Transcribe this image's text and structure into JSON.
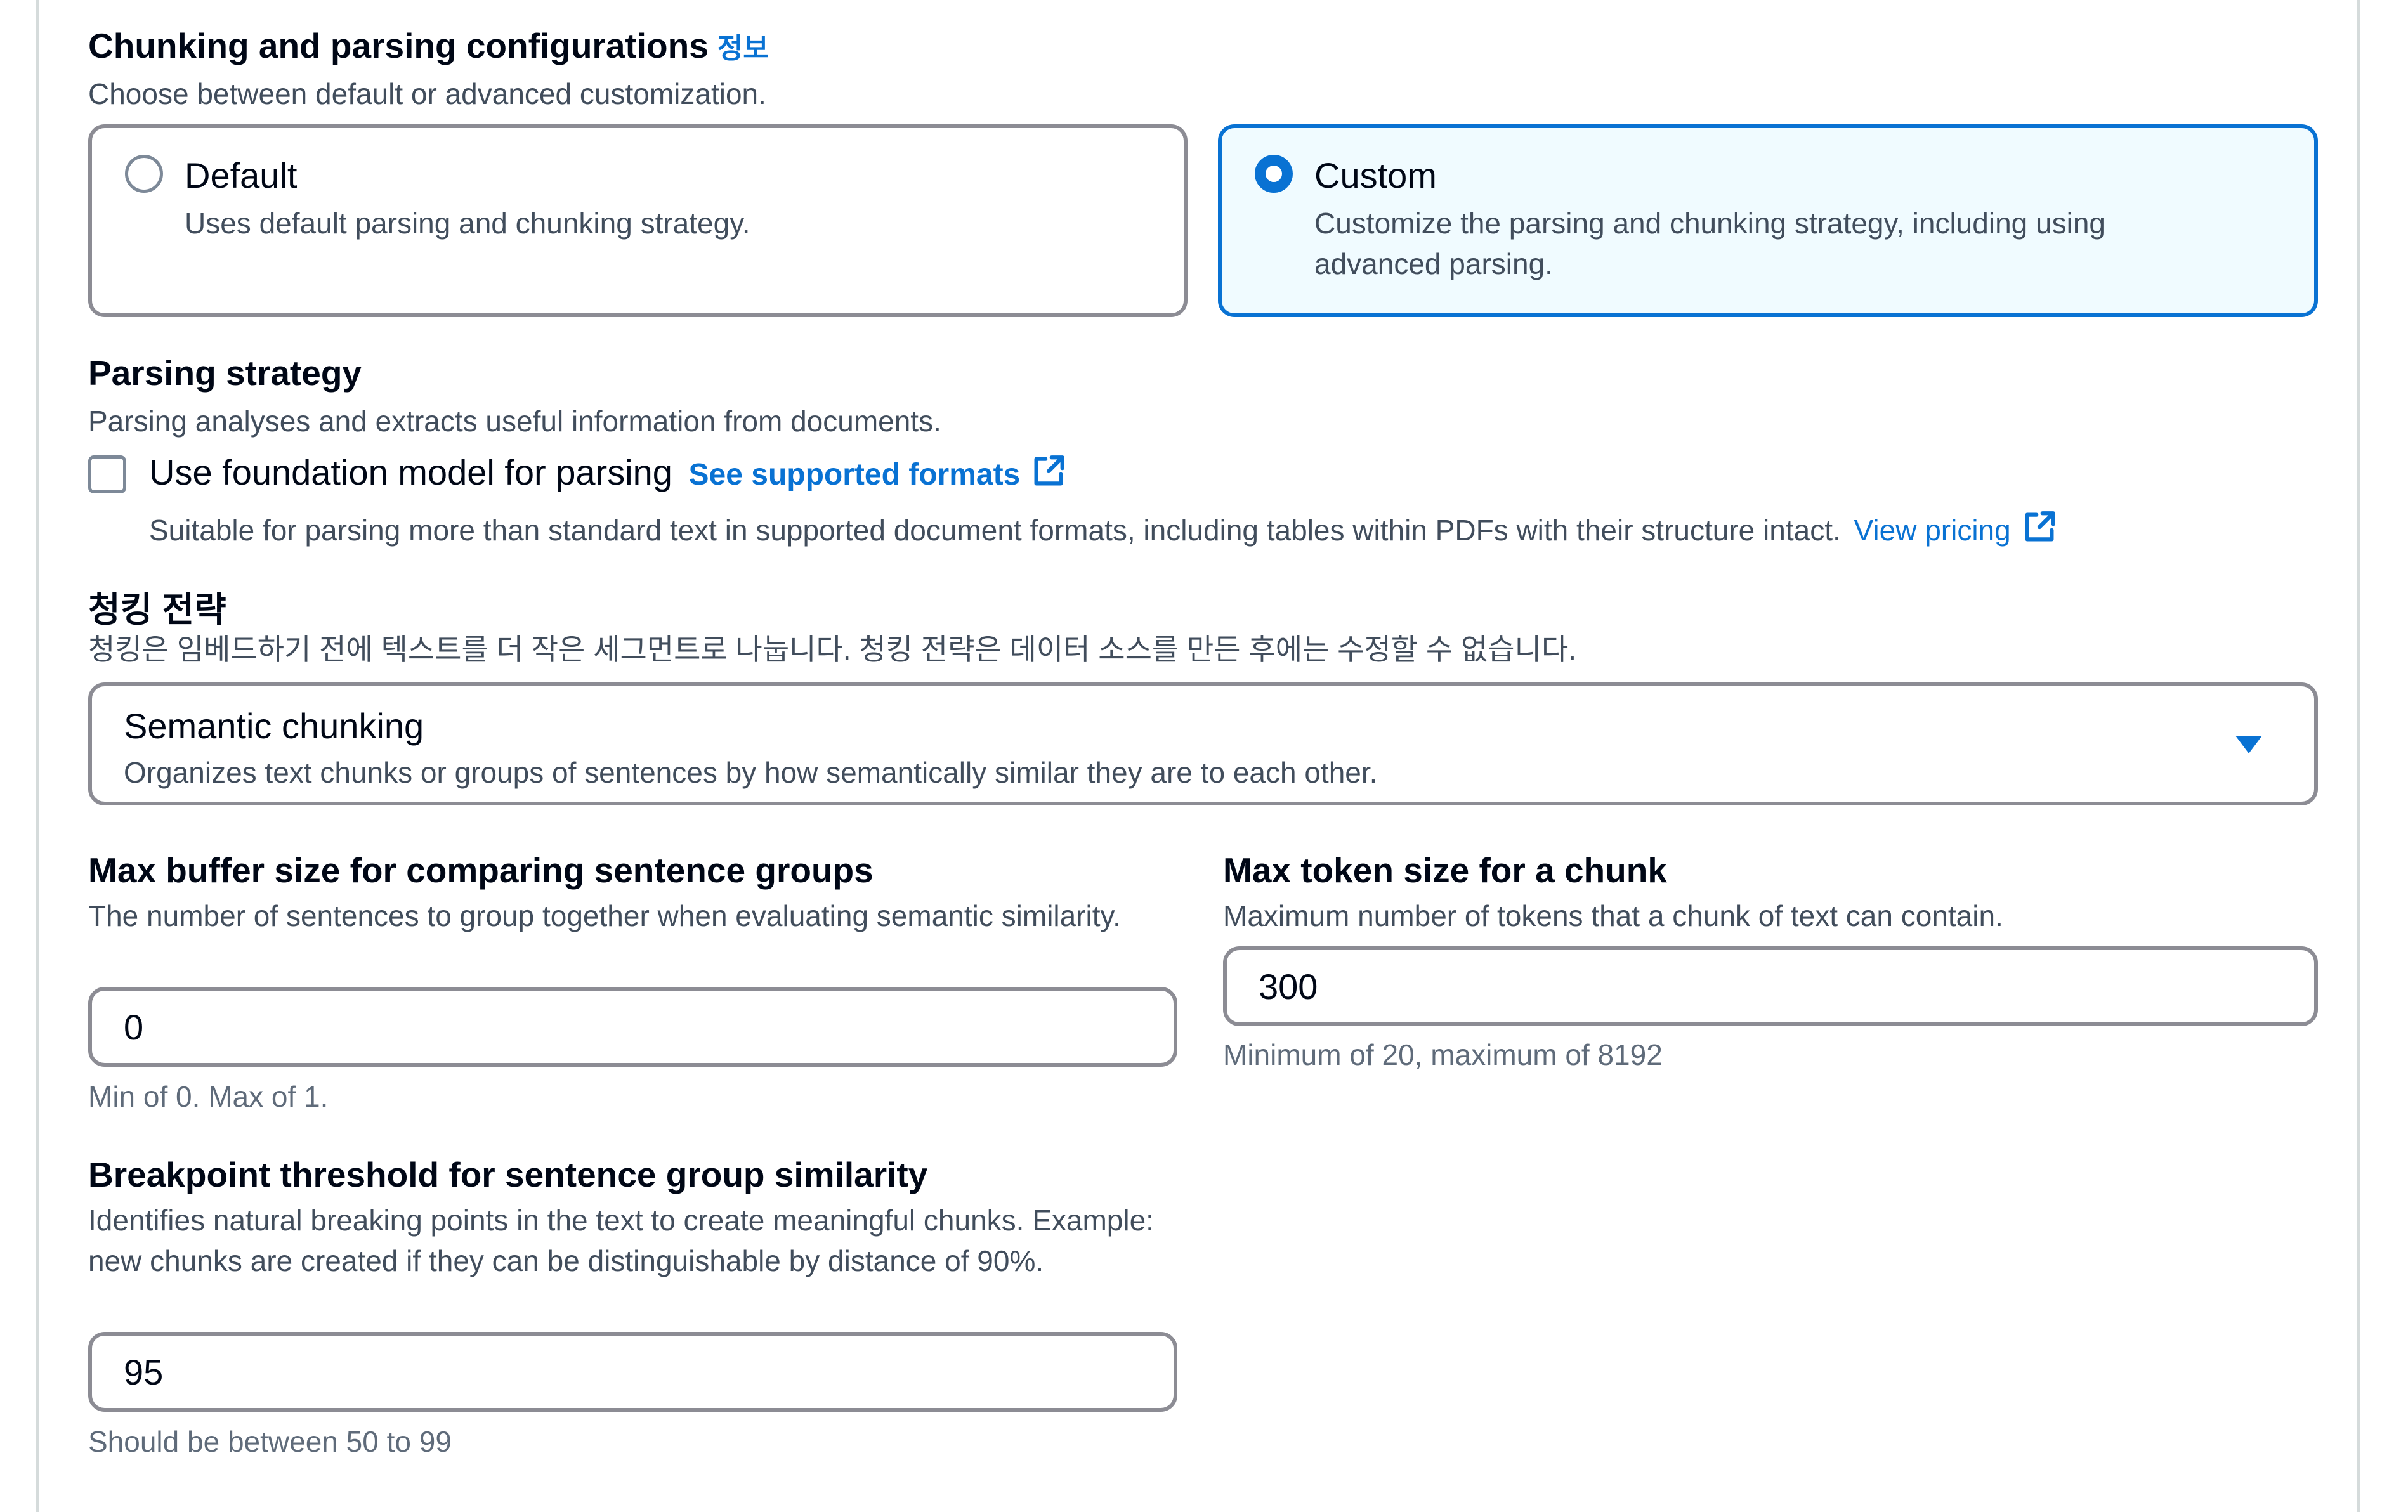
{
  "chunking": {
    "title": "Chunking and parsing configurations",
    "info_link": "정보",
    "description": "Choose between default or advanced customization.",
    "options": [
      {
        "title": "Default",
        "description": "Uses default parsing and chunking strategy.",
        "selected": false
      },
      {
        "title": "Custom",
        "description": "Customize the parsing and chunking strategy, including using advanced parsing.",
        "selected": true
      }
    ]
  },
  "parsing": {
    "title": "Parsing strategy",
    "description": "Parsing analyses and extracts useful information from documents.",
    "checkbox_label": "Use foundation model for parsing",
    "checked": false,
    "formats_link": "See supported formats",
    "suitable_text": "Suitable for parsing more than standard text in supported document formats, including tables within PDFs with their structure intact.",
    "pricing_link": "View pricing"
  },
  "strategy": {
    "title": "청킹 전략",
    "description": "청킹은 임베드하기 전에 텍스트를 더 작은 세그먼트로 나눕니다. 청킹 전략은 데이터 소스를 만든 후에는 수정할 수 없습니다.",
    "selected_label": "Semantic chunking",
    "selected_description": "Organizes text chunks or groups of sentences by how semantically similar they are to each other."
  },
  "buffer": {
    "title": "Max buffer size for comparing sentence groups",
    "description": "The number of sentences to group together when evaluating semantic similarity.",
    "value": "0",
    "hint": "Min of 0. Max of 1."
  },
  "token": {
    "title": "Max token size for a chunk",
    "description": "Maximum number of tokens that a chunk of text can contain.",
    "value": "300",
    "hint": "Minimum of 20, maximum of 8192"
  },
  "breakpoint": {
    "title": "Breakpoint threshold for sentence group similarity",
    "description": "Identifies natural breaking points in the text to create meaningful chunks. Example: new chunks are created if they can be distinguishable by distance of 90%.",
    "value": "95",
    "hint": "Should be between 50 to 99"
  },
  "colors": {
    "accent": "#0972d3",
    "selected_bg": "#f0fbff",
    "border": "#8c8c94"
  },
  "icons": {
    "external": "external-link-icon",
    "dropdown": "caret-down-icon"
  }
}
